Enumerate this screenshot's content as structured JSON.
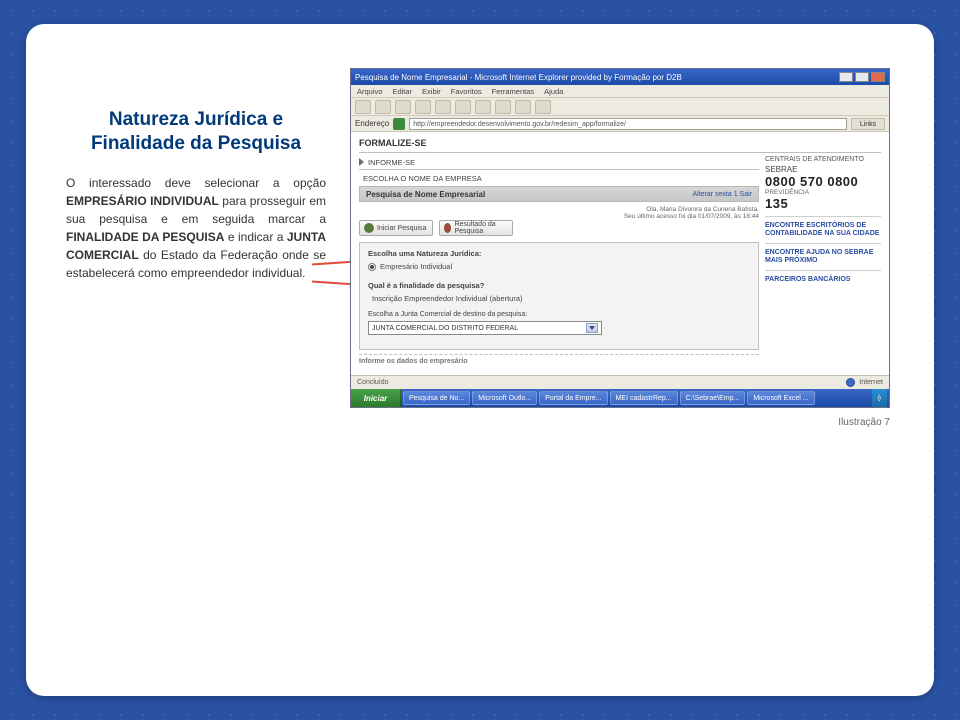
{
  "title": "Natureza Jurídica e Finalidade da Pesquisa",
  "body_parts": {
    "p1a": "O interessado deve selecionar a opção ",
    "p1b": "EMPRESÁRIO INDIVIDUAL",
    "p1c": " para prosseguir em sua pesquisa e em seguida marcar a ",
    "p1d": "FINALIDADE DA PESQUISA",
    "p1e": " e indicar a ",
    "p1f": "JUNTA COMERCIAL",
    "p1g": " do Estado da Federação onde se estabelecerá como empreendedor individual."
  },
  "caption": "Ilustração 7",
  "screenshot": {
    "window_title": "Pesquisa de Nome Empresarial - Microsoft Internet Explorer provided by Formação por D2B",
    "menu": [
      "Arquivo",
      "Editar",
      "Exibir",
      "Favoritos",
      "Ferramentas",
      "Ajuda"
    ],
    "address_label": "Endereço",
    "address_url": "http://empreendedor.desenvolvimento.gov.br/redesim_app/formalize/",
    "links_label": "Links",
    "formalize": "FORMALIZE-SE",
    "nav1": "INFORME-SE",
    "nav2": "ESCOLHA O NOME DA EMPRESA",
    "band_title": "Pesquisa de Nome Empresarial",
    "band_right": "Alterar sexta 1 Sair",
    "meta_left": "",
    "meta_right": "Olá, Maria Divonira da Cunena Batista.\nSeu último acesso foi dia 01/07/2009, às 18:44",
    "btn_iniciar": "Iniciar Pesquisa",
    "btn_resultado": "Resultado da Pesquisa",
    "lbl_natureza": "Escolha uma Natureza Jurídica:",
    "radio_natureza": "Empresário Individual",
    "lbl_finalidade": "Qual é a finalidade da pesquisa?",
    "radio_finalidade": "Inscrição Empreendedor Individual (abertura)",
    "lbl_junta": "Escolha a Junta Comercial de destino da pesquisa:",
    "select_junta": "JUNTA COMERCIAL DO DISTRITO FEDERAL",
    "cut_label": "Informe os dados do empresário",
    "sidebar": {
      "hdr": "CENTRAIS DE ATENDIMENTO",
      "brand": "SEBRAE",
      "phone": "0800 570 0800",
      "prev_lbl": "PREVIDÊNCIA",
      "prev_num": "135",
      "l1": "ENCONTRE ESCRITÓRIOS DE CONTABILIDADE NA SUA CIDADE",
      "l2": "ENCONTRE AJUDA NO SEBRAE MAIS PRÓXIMO",
      "l3": "PARCEIROS BANCÁRIOS"
    },
    "status_left": "Concluído",
    "status_right": "Internet",
    "taskbar": {
      "start": "Iniciar",
      "items": [
        "Pesquisa de No...",
        "Microsoft Outlo...",
        "Portal da Empre...",
        "MEI cadastrRep...",
        "C:\\Sebrae\\Emp...",
        "Microsoft Excel ..."
      ]
    }
  }
}
